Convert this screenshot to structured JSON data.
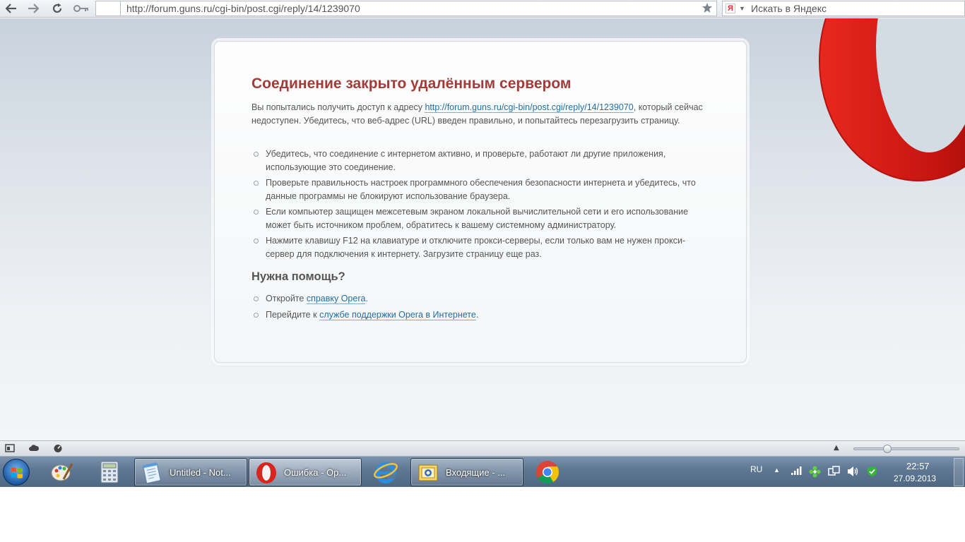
{
  "browser": {
    "address_url": "http://forum.guns.ru/cgi-bin/post.cgi/reply/14/1239070",
    "search_placeholder": "Искать в Яндекс",
    "search_engine_letter": "Я",
    "icons": [
      "back-icon",
      "forward-icon",
      "reload-icon",
      "key-icon",
      "star-icon",
      "yandex-icon",
      "opera-logo"
    ]
  },
  "error_page": {
    "title": "Соединение закрыто удалённым сервером",
    "intro_before": "Вы попытались получить доступ к адресу ",
    "intro_link": "http://forum.guns.ru/cgi-bin/post.cgi/reply/14/1239070",
    "intro_after": ", который сейчас недоступен. Убедитесь, что веб-адрес (URL) введен правильно, и попытайтесь перезагрузить страницу.",
    "tips": [
      "Убедитесь, что соединение с интернетом активно, и проверьте, работают ли другие приложения, использующие это соединение.",
      "Проверьте правильность настроек программного обеспечения безопасности интернета и убедитесь, что данные программы не блокируют использование браузера.",
      "Если компьютер защищен межсетевым экраном локальной вычислительной сети и его использование может быть источником проблем, обратитесь к вашему системному администратору.",
      "Нажмите клавишу F12 на клавиатуре и отключите прокси-серверы, если только вам не нужен прокси-сервер для подключения к интернету. Загрузите страницу еще раз."
    ],
    "help_heading": "Нужна помощь?",
    "help_1_before": "Откройте ",
    "help_1_link": "справку Opera",
    "help_1_after": ".",
    "help_2_before": "Перейдите к ",
    "help_2_link": "службе поддержки Opera в Интернете",
    "help_2_after": "."
  },
  "statusbar": {
    "icons": [
      "panel-toggle-icon",
      "turbo-cloud-icon",
      "speed-dial-icon",
      "zoom-up-icon"
    ],
    "zoom_fraction": 0.3
  },
  "taskbar": {
    "windows": [
      {
        "label": "Untitled - Not...",
        "icon": "notepad-icon",
        "active": false
      },
      {
        "label": "Ошибка - Op...",
        "icon": "opera-icon",
        "active": true
      },
      {
        "label": "Входящие - ...",
        "icon": "outlook-icon",
        "active": false
      }
    ],
    "pinned": [
      "paint-icon",
      "calculator-icon",
      "ie-icon",
      "chrome-icon"
    ],
    "language": "RU",
    "time": "22:57",
    "date": "27.09.2013",
    "accent": "#a33b38"
  }
}
